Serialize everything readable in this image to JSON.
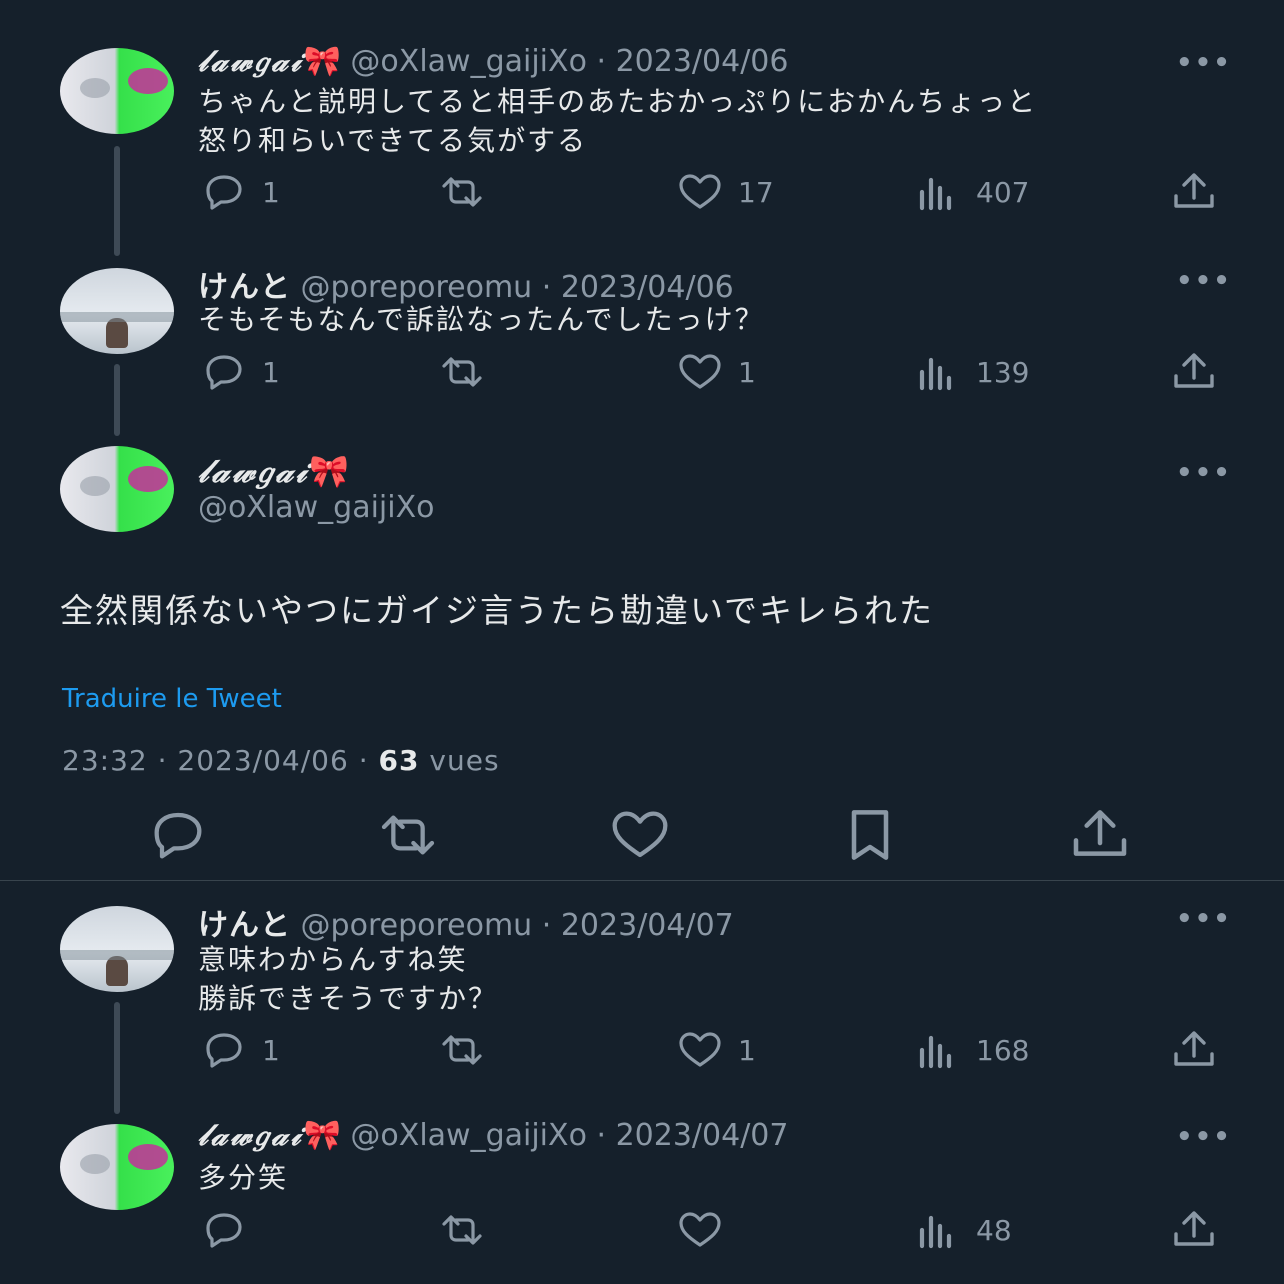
{
  "tweets": [
    {
      "name": "𝓁𝒶𝓌𝑔𝒶𝒾",
      "bow": "🎀",
      "handle": "@oXlaw_gaijiXo",
      "date": "2023/04/06",
      "text_lines": [
        "ちゃんと説明してると相手のあたおかっぷりにおかんちょっと",
        "怒り和らいできてる気がする"
      ],
      "replies": "1",
      "retweets": "",
      "likes": "17",
      "views": "407"
    },
    {
      "name": "けんと",
      "handle": "@poreporeomu",
      "date": "2023/04/06",
      "text_lines": [
        "そもそもなんで訴訟なったんでしたっけ？"
      ],
      "replies": "1",
      "retweets": "",
      "likes": "1",
      "views": "139"
    }
  ],
  "main_tweet": {
    "name": "𝓁𝒶𝓌𝑔𝒶𝒾",
    "bow": "🎀",
    "handle": "@oXlaw_gaijiXo",
    "text": "全然関係ないやつにガイジ言うたら勘違いでキレられた",
    "translate": "Traduire le Tweet",
    "time": "23:32",
    "date": "2023/04/06",
    "views_count": "63",
    "views_label": "vues",
    "separator": "·"
  },
  "replies": [
    {
      "name": "けんと",
      "handle": "@poreporeomu",
      "date": "2023/04/07",
      "text_lines": [
        "意味わからんすね笑",
        "勝訴できそうですか？"
      ],
      "replies": "1",
      "retweets": "",
      "likes": "1",
      "views": "168"
    },
    {
      "name": "𝓁𝒶𝓌𝑔𝒶𝒾",
      "bow": "🎀",
      "handle": "@oXlaw_gaijiXo",
      "date": "2023/04/07",
      "text_lines": [
        "多分笑"
      ],
      "replies": "",
      "retweets": "",
      "likes": "",
      "views": "48"
    }
  ],
  "ui": {
    "more": "•••",
    "sep": "·"
  }
}
